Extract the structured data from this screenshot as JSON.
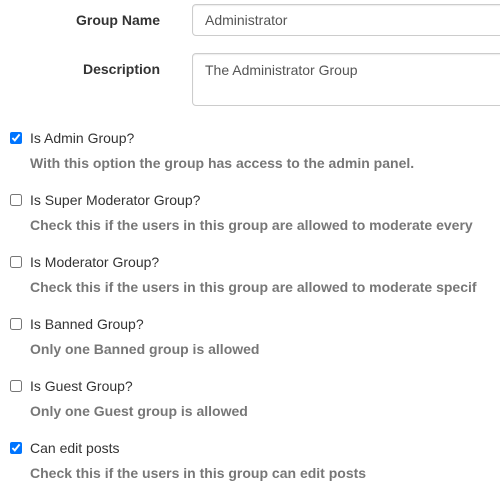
{
  "form": {
    "group_name": {
      "label": "Group Name",
      "value": "Administrator"
    },
    "description": {
      "label": "Description",
      "value": "The Administrator Group"
    },
    "options": [
      {
        "label": "Is Admin Group?",
        "checked": true,
        "help": "With this option the group has access to the admin panel."
      },
      {
        "label": "Is Super Moderator Group?",
        "checked": false,
        "help": "Check this if the users in this group are allowed to moderate every"
      },
      {
        "label": "Is Moderator Group?",
        "checked": false,
        "help": "Check this if the users in this group are allowed to moderate specif"
      },
      {
        "label": "Is Banned Group?",
        "checked": false,
        "help": "Only one Banned group is allowed"
      },
      {
        "label": "Is Guest Group?",
        "checked": false,
        "help": "Only one Guest group is allowed"
      },
      {
        "label": "Can edit posts",
        "checked": true,
        "help": "Check this if the users in this group can edit posts"
      }
    ]
  }
}
